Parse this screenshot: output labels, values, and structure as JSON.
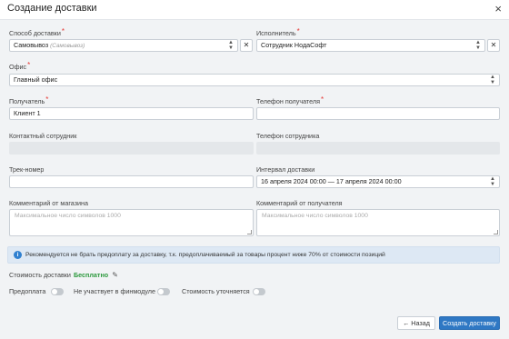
{
  "dialog": {
    "title": "Создание доставки",
    "close_icon": "×"
  },
  "form": {
    "delivery_method": {
      "label": "Способ доставки",
      "value": "Самовывоз",
      "hint": "(Самовывоз)"
    },
    "executor": {
      "label": "Исполнитель",
      "value": "Сотрудник НодаСофт"
    },
    "office": {
      "label": "Офис",
      "value": "Главный офис"
    },
    "recipient": {
      "label": "Получатель",
      "value": "Клиент 1"
    },
    "recipient_phone": {
      "label": "Телефон получателя",
      "value": ""
    },
    "contact_employee": {
      "label": "Контактный сотрудник",
      "value": ""
    },
    "employee_phone": {
      "label": "Телефон сотрудника",
      "value": ""
    },
    "tracking": {
      "label": "Трек-номер",
      "value": ""
    },
    "interval": {
      "label": "Интервал доставки",
      "value": "16 апреля 2024 00:00 — 17 апреля 2024 00:00"
    },
    "shop_comment": {
      "label": "Комментарий от магазина",
      "placeholder": "Максимальное число символов 1000"
    },
    "recipient_comment": {
      "label": "Комментарий от получателя",
      "placeholder": "Максимальное число символов 1000"
    }
  },
  "info": {
    "text": "Рекомендуется не брать предоплату за доставку, т.к. предоплачиваемый за товары процент ниже 70% от стоимости позиций",
    "icon": "info-icon"
  },
  "cost": {
    "label": "Стоимость доставки",
    "value": "Бесплатно",
    "icon": "pencil-icon"
  },
  "toggles": [
    {
      "label": "Предоплата",
      "on": false
    },
    {
      "label": "Не участвует в финмодуле",
      "on": false
    },
    {
      "label": "Стоимость уточняется",
      "on": false
    }
  ],
  "buttons": {
    "back": "Назад",
    "create": "Создать доставку"
  },
  "colors": {
    "primary": "#2f78c4",
    "success": "#2e9a3f",
    "required": "#e53935",
    "info_bg": "#dde8f4"
  }
}
